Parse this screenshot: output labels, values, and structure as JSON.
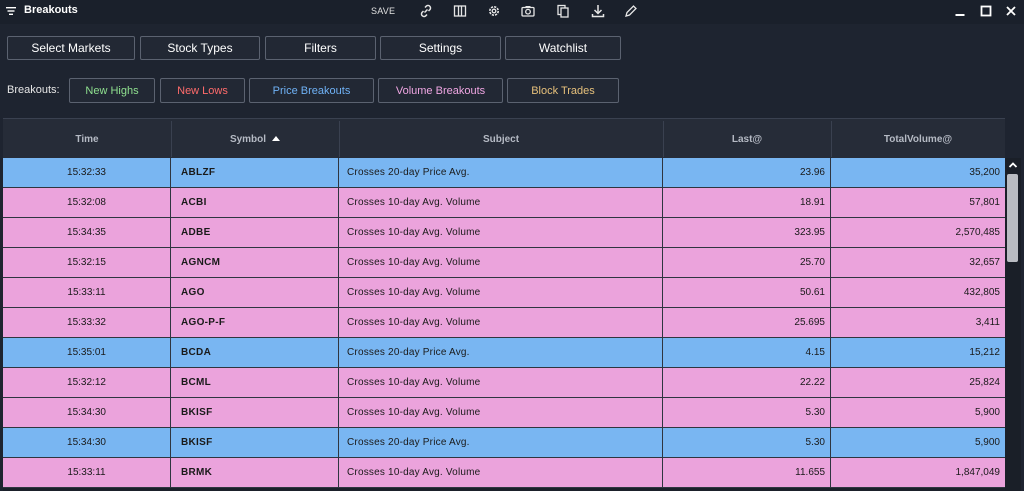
{
  "window": {
    "title": "Breakouts",
    "save_label": "SAVE",
    "toolbar_icons": [
      "link-icon",
      "columns-icon",
      "gear-icon",
      "camera-icon",
      "copy-icon",
      "download-icon",
      "pencil-icon"
    ],
    "window_controls": [
      "minimize-icon",
      "maximize-icon",
      "close-icon"
    ]
  },
  "top_buttons": {
    "select_markets": "Select Markets",
    "stock_types": "Stock Types",
    "filters": "Filters",
    "settings": "Settings",
    "watchlist": "Watchlist"
  },
  "breakouts_bar": {
    "label": "Breakouts:",
    "new_highs": "New Highs",
    "new_lows": "New Lows",
    "price_breakouts": "Price Breakouts",
    "volume_breakouts": "Volume Breakouts",
    "block_trades": "Block Trades"
  },
  "colors": {
    "new_highs": "#8fe08f",
    "new_lows": "#ff6b6b",
    "price_breakouts": "#6fb1f5",
    "volume_breakouts": "#f0a6e3",
    "block_trades": "#e6c07b",
    "row_price": "#79b6f2",
    "row_volume": "#eba3dc"
  },
  "table": {
    "columns": {
      "time": "Time",
      "symbol": "Symbol",
      "subject": "Subject",
      "last": "Last@",
      "total_volume": "TotalVolume@"
    },
    "sorted_by": "symbol",
    "sort_direction": "ascending",
    "rows": [
      {
        "time": "15:32:33",
        "symbol": "ABLZF",
        "subject": "Crosses 20-day Price Avg.",
        "last": "23.96",
        "volume": "35,200",
        "type": "price"
      },
      {
        "time": "15:32:08",
        "symbol": "ACBI",
        "subject": "Crosses 10-day Avg. Volume",
        "last": "18.91",
        "volume": "57,801",
        "type": "volume"
      },
      {
        "time": "15:34:35",
        "symbol": "ADBE",
        "subject": "Crosses 10-day Avg. Volume",
        "last": "323.95",
        "volume": "2,570,485",
        "type": "volume"
      },
      {
        "time": "15:32:15",
        "symbol": "AGNCM",
        "subject": "Crosses 10-day Avg. Volume",
        "last": "25.70",
        "volume": "32,657",
        "type": "volume"
      },
      {
        "time": "15:33:11",
        "symbol": "AGO",
        "subject": "Crosses 10-day Avg. Volume",
        "last": "50.61",
        "volume": "432,805",
        "type": "volume"
      },
      {
        "time": "15:33:32",
        "symbol": "AGO-P-F",
        "subject": "Crosses 10-day Avg. Volume",
        "last": "25.695",
        "volume": "3,411",
        "type": "volume"
      },
      {
        "time": "15:35:01",
        "symbol": "BCDA",
        "subject": "Crosses 20-day Price Avg.",
        "last": "4.15",
        "volume": "15,212",
        "type": "price"
      },
      {
        "time": "15:32:12",
        "symbol": "BCML",
        "subject": "Crosses 10-day Avg. Volume",
        "last": "22.22",
        "volume": "25,824",
        "type": "volume"
      },
      {
        "time": "15:34:30",
        "symbol": "BKISF",
        "subject": "Crosses 10-day Avg. Volume",
        "last": "5.30",
        "volume": "5,900",
        "type": "volume"
      },
      {
        "time": "15:34:30",
        "symbol": "BKISF",
        "subject": "Crosses 20-day Price Avg.",
        "last": "5.30",
        "volume": "5,900",
        "type": "price"
      },
      {
        "time": "15:33:11",
        "symbol": "BRMK",
        "subject": "Crosses 10-day Avg. Volume",
        "last": "11.655",
        "volume": "1,847,049",
        "type": "volume"
      }
    ]
  }
}
